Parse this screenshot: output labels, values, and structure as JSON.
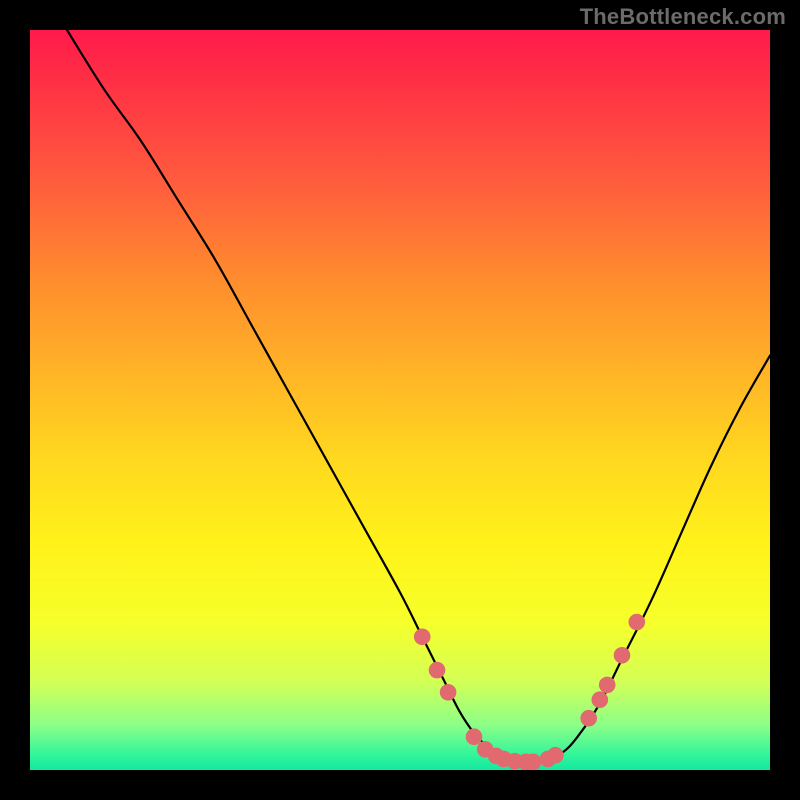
{
  "watermark": "TheBottleneck.com",
  "colors": {
    "dot": "#e06a6f",
    "curve": "#000000"
  },
  "chart_data": {
    "type": "line",
    "title": "",
    "xlabel": "",
    "ylabel": "",
    "xlim": [
      0,
      100
    ],
    "ylim": [
      0,
      100
    ],
    "grid": false,
    "legend": false,
    "series": [
      {
        "name": "curve",
        "x": [
          5,
          10,
          15,
          20,
          25,
          30,
          35,
          40,
          45,
          50,
          53,
          56,
          58,
          60,
          62,
          64,
          66,
          68,
          70,
          72,
          74,
          77,
          80,
          84,
          88,
          92,
          96,
          100
        ],
        "y": [
          100,
          92,
          85,
          77,
          69,
          60,
          51,
          42,
          33,
          24,
          18,
          12,
          8,
          5,
          3,
          1.7,
          1.1,
          1.0,
          1.4,
          2.4,
          4.5,
          9,
          15,
          23,
          32,
          41,
          49,
          56
        ]
      }
    ],
    "points": [
      {
        "x": 53.0,
        "y": 18.0
      },
      {
        "x": 55.0,
        "y": 13.5
      },
      {
        "x": 56.5,
        "y": 10.5
      },
      {
        "x": 60.0,
        "y": 4.5
      },
      {
        "x": 61.5,
        "y": 2.8
      },
      {
        "x": 63.0,
        "y": 1.9
      },
      {
        "x": 64.0,
        "y": 1.5
      },
      {
        "x": 65.5,
        "y": 1.2
      },
      {
        "x": 67.0,
        "y": 1.1
      },
      {
        "x": 68.0,
        "y": 1.1
      },
      {
        "x": 70.0,
        "y": 1.5
      },
      {
        "x": 71.0,
        "y": 2.0
      },
      {
        "x": 75.5,
        "y": 7.0
      },
      {
        "x": 77.0,
        "y": 9.5
      },
      {
        "x": 78.0,
        "y": 11.5
      },
      {
        "x": 80.0,
        "y": 15.5
      },
      {
        "x": 82.0,
        "y": 20.0
      }
    ]
  }
}
